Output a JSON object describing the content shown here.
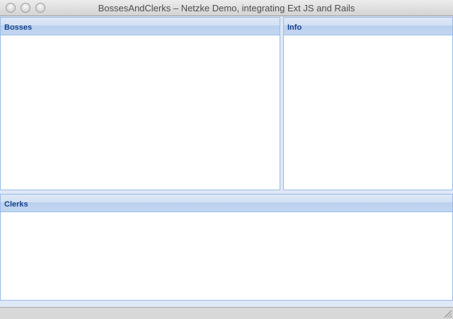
{
  "window": {
    "title": "BossesAndClerks – Netzke Demo, integrating Ext JS and Rails"
  },
  "panels": {
    "bosses": "Bosses",
    "info": "Info",
    "clerks": "Clerks"
  }
}
